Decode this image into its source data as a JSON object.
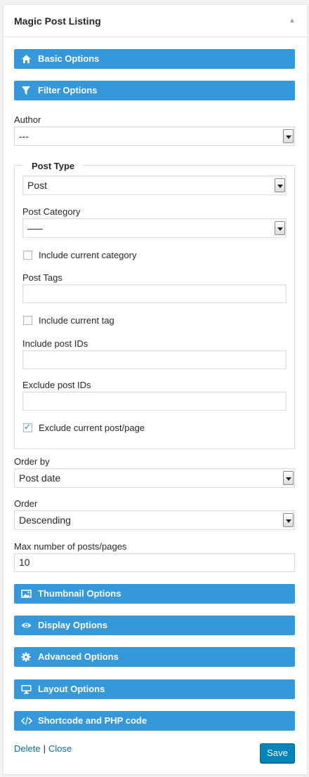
{
  "widget": {
    "title": "Magic Post Listing",
    "toggle_icon": "caret-up-icon"
  },
  "sections": {
    "basic": {
      "label": "Basic Options",
      "icon": "home-icon"
    },
    "filter": {
      "label": "Filter Options",
      "icon": "filter-icon"
    },
    "thumbnail": {
      "label": "Thumbnail Options",
      "icon": "image-icon"
    },
    "display": {
      "label": "Display Options",
      "icon": "eye-icon"
    },
    "advanced": {
      "label": "Advanced Options",
      "icon": "gear-icon"
    },
    "layout": {
      "label": "Layout Options",
      "icon": "monitor-icon"
    },
    "shortcode": {
      "label": "Shortcode and PHP code",
      "icon": "code-icon"
    }
  },
  "filter": {
    "author_label": "Author",
    "author_value": "---",
    "post_type_legend": "Post Type",
    "post_type_value": "Post",
    "post_category_label": "Post Category",
    "post_category_value": "—–",
    "include_current_category_label": "Include current category",
    "include_current_category_checked": false,
    "post_tags_label": "Post Tags",
    "post_tags_value": "",
    "include_current_tag_label": "Include current tag",
    "include_current_tag_checked": false,
    "include_ids_label": "Include post IDs",
    "include_ids_value": "",
    "exclude_ids_label": "Exclude post IDs",
    "exclude_ids_value": "",
    "exclude_current_label": "Exclude current post/page",
    "exclude_current_checked": true,
    "order_by_label": "Order by",
    "order_by_value": "Post date",
    "order_label": "Order",
    "order_value": "Descending",
    "max_posts_label": "Max number of posts/pages",
    "max_posts_value": "10"
  },
  "footer": {
    "delete_label": "Delete",
    "separator": "|",
    "close_label": "Close",
    "save_label": "Save"
  },
  "colors": {
    "section_bar": "#3498db",
    "link": "#0073aa",
    "save_button": "#0085ba"
  }
}
